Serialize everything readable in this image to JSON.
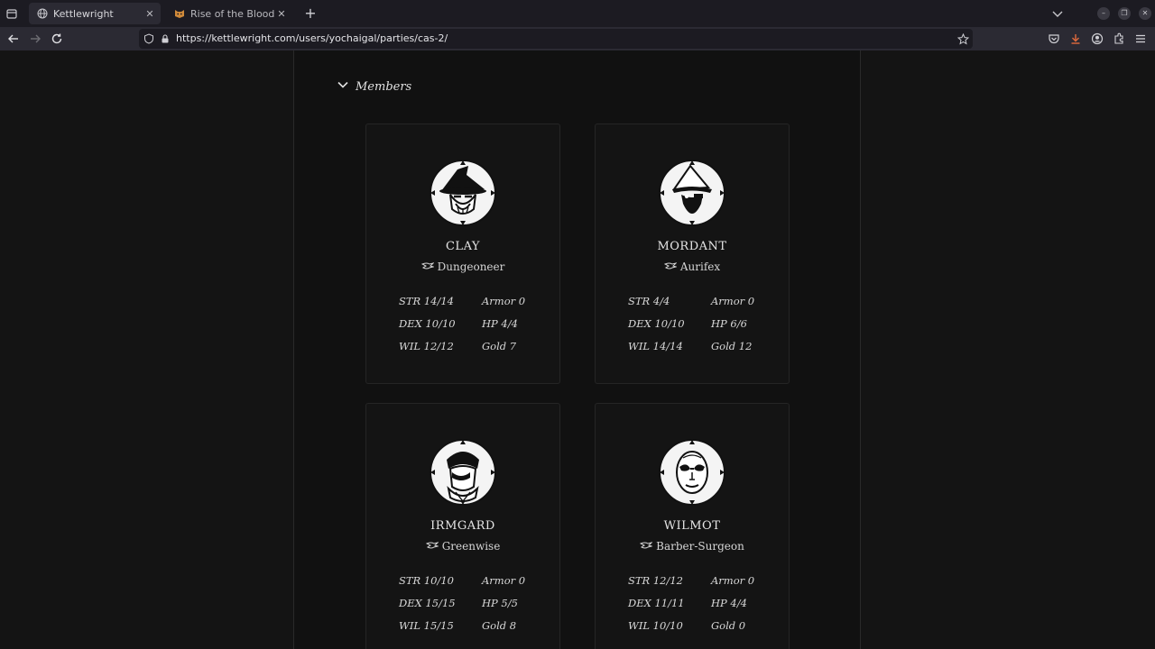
{
  "browser": {
    "tabs": [
      {
        "title": "Kettlewright",
        "active": true
      },
      {
        "title": "Rise of the Blood Olms |",
        "active": false
      }
    ],
    "url": "https://kettlewright.com/users/yochaigal/parties/cas-2/"
  },
  "page": {
    "members_label": "Members",
    "members": [
      {
        "name": "CLAY",
        "background": "Dungeoneer",
        "stats": {
          "str": "STR 14/14",
          "dex": "DEX 10/10",
          "wil": "WIL 12/12",
          "armor": "Armor 0",
          "hp": "HP 4/4",
          "gold": "Gold 7"
        }
      },
      {
        "name": "MORDANT",
        "background": "Aurifex",
        "stats": {
          "str": "STR 4/4",
          "dex": "DEX 10/10",
          "wil": "WIL 14/14",
          "armor": "Armor 0",
          "hp": "HP 6/6",
          "gold": "Gold 12"
        }
      },
      {
        "name": "IRMGARD",
        "background": "Greenwise",
        "stats": {
          "str": "STR 10/10",
          "dex": "DEX 15/15",
          "wil": "WIL 15/15",
          "armor": "Armor 0",
          "hp": "HP 5/5",
          "gold": "Gold 8"
        }
      },
      {
        "name": "WILMOT",
        "background": "Barber-Surgeon",
        "stats": {
          "str": "STR 12/12",
          "dex": "DEX 11/11",
          "wil": "WIL 10/10",
          "armor": "Armor 0",
          "hp": "HP 4/4",
          "gold": "Gold 0"
        }
      }
    ]
  }
}
